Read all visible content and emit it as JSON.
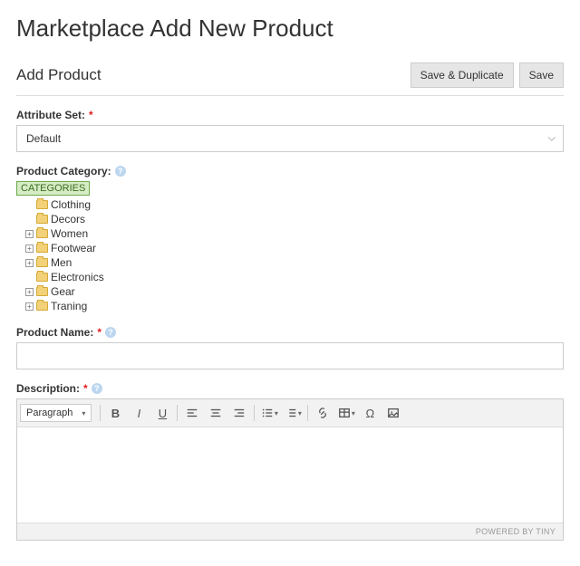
{
  "page_title": "Marketplace Add New Product",
  "subtitle": "Add Product",
  "buttons": {
    "save_duplicate": "Save & Duplicate",
    "save": "Save"
  },
  "attribute_set": {
    "label": "Attribute Set:",
    "value": "Default"
  },
  "product_category": {
    "label": "Product Category:",
    "root": "CATEGORIES",
    "items": [
      {
        "label": "Clothing",
        "expandable": false
      },
      {
        "label": "Decors",
        "expandable": false
      },
      {
        "label": "Women",
        "expandable": true
      },
      {
        "label": "Footwear",
        "expandable": true
      },
      {
        "label": "Men",
        "expandable": true
      },
      {
        "label": "Electronics",
        "expandable": false
      },
      {
        "label": "Gear",
        "expandable": true
      },
      {
        "label": "Traning",
        "expandable": true
      }
    ]
  },
  "product_name": {
    "label": "Product Name:"
  },
  "description": {
    "label": "Description:",
    "format_label": "Paragraph",
    "powered_by": "POWERED BY TINY"
  }
}
